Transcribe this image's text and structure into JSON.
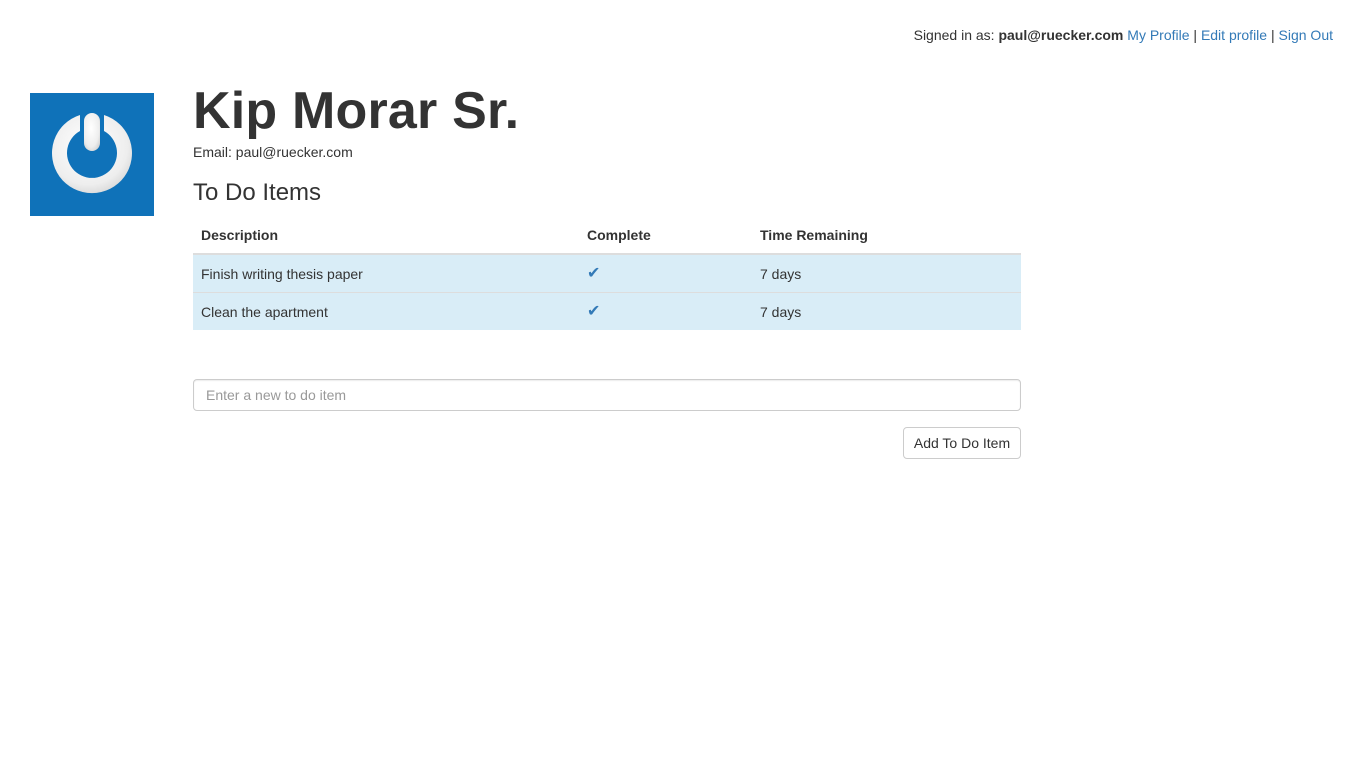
{
  "topbar": {
    "signed_in_label": "Signed in as:",
    "user_email": "paul@ruecker.com",
    "links": {
      "my_profile": "My Profile",
      "edit_profile": "Edit profile",
      "sign_out": "Sign Out"
    },
    "separator": "|"
  },
  "profile": {
    "avatar_icon": "gravatar-power-icon",
    "name": "Kip Morar Sr.",
    "email_label": "Email:",
    "email": "paul@ruecker.com"
  },
  "todos": {
    "title": "To Do Items",
    "columns": {
      "description": "Description",
      "complete": "Complete",
      "time_remaining": "Time Remaining"
    },
    "rows": [
      {
        "description": "Finish writing thesis paper",
        "complete": "✔",
        "time_remaining": "7 days"
      },
      {
        "description": "Clean the apartment",
        "complete": "✔",
        "time_remaining": "7 days"
      }
    ],
    "row_highlight_color": "#d9edf7",
    "check_color": "#337ab7"
  },
  "form": {
    "new_item_value": "",
    "new_item_placeholder": "Enter a new to do item",
    "add_button_label": "Add To Do Item"
  },
  "colors": {
    "link": "#337ab7",
    "avatar_bg": "#0f72b9"
  }
}
